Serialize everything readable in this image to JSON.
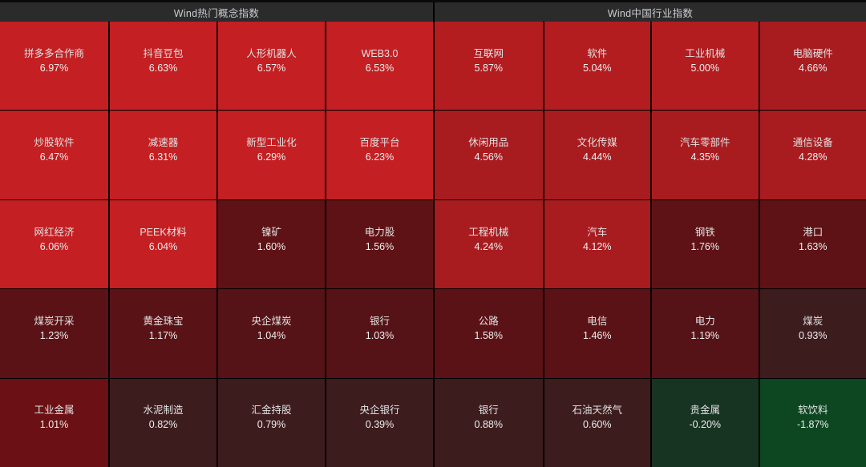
{
  "panels": [
    {
      "title": "Wind热门概念指数",
      "rows": [
        [
          {
            "name": "拼多多合作商",
            "value": "6.97%",
            "color": "#c41f22"
          },
          {
            "name": "抖音豆包",
            "value": "6.63%",
            "color": "#c41f22"
          },
          {
            "name": "人形机器人",
            "value": "6.57%",
            "color": "#c41f22"
          },
          {
            "name": "WEB3.0",
            "value": "6.53%",
            "color": "#c41f22"
          }
        ],
        [
          {
            "name": "炒股软件",
            "value": "6.47%",
            "color": "#c41f22"
          },
          {
            "name": "减速器",
            "value": "6.31%",
            "color": "#c41f22"
          },
          {
            "name": "新型工业化",
            "value": "6.29%",
            "color": "#c41f22"
          },
          {
            "name": "百度平台",
            "value": "6.23%",
            "color": "#c41f22"
          }
        ],
        [
          {
            "name": "网红经济",
            "value": "6.06%",
            "color": "#c41f22"
          },
          {
            "name": "PEEK材料",
            "value": "6.04%",
            "color": "#c41f22"
          },
          {
            "name": "镍矿",
            "value": "1.60%",
            "color": "#5e1215"
          },
          {
            "name": "电力股",
            "value": "1.56%",
            "color": "#5e1215"
          }
        ],
        [
          {
            "name": "煤炭开采",
            "value": "1.23%",
            "color": "#5b1216"
          },
          {
            "name": "黄金珠宝",
            "value": "1.17%",
            "color": "#591317"
          },
          {
            "name": "央企煤炭",
            "value": "1.04%",
            "color": "#561317"
          },
          {
            "name": "银行",
            "value": "1.03%",
            "color": "#561317"
          }
        ],
        [
          {
            "name": "工业金属",
            "value": "1.01%",
            "color": "#6b1014"
          },
          {
            "name": "水泥制造",
            "value": "0.82%",
            "color": "#3d1c1e"
          },
          {
            "name": "汇金持股",
            "value": "0.79%",
            "color": "#3d1c1e"
          },
          {
            "name": "央企银行",
            "value": "0.39%",
            "color": "#3d1c1e"
          }
        ]
      ]
    },
    {
      "title": "Wind中国行业指数",
      "rows": [
        [
          {
            "name": "互联网",
            "value": "5.87%",
            "color": "#b31d20"
          },
          {
            "name": "软件",
            "value": "5.04%",
            "color": "#b31d20"
          },
          {
            "name": "工业机械",
            "value": "5.00%",
            "color": "#b31d20"
          },
          {
            "name": "电脑硬件",
            "value": "4.66%",
            "color": "#a81c20"
          }
        ],
        [
          {
            "name": "休闲用品",
            "value": "4.56%",
            "color": "#a81c20"
          },
          {
            "name": "文化传媒",
            "value": "4.44%",
            "color": "#a81c20"
          },
          {
            "name": "汽车零部件",
            "value": "4.35%",
            "color": "#a81c20"
          },
          {
            "name": "通信设备",
            "value": "4.28%",
            "color": "#a81c20"
          }
        ],
        [
          {
            "name": "工程机械",
            "value": "4.24%",
            "color": "#a81c20"
          },
          {
            "name": "汽车",
            "value": "4.12%",
            "color": "#a81c20"
          },
          {
            "name": "钢铁",
            "value": "1.76%",
            "color": "#5e1215"
          },
          {
            "name": "港口",
            "value": "1.63%",
            "color": "#5e1215"
          }
        ],
        [
          {
            "name": "公路",
            "value": "1.58%",
            "color": "#5b1216"
          },
          {
            "name": "电信",
            "value": "1.46%",
            "color": "#5b1216"
          },
          {
            "name": "电力",
            "value": "1.19%",
            "color": "#561317"
          },
          {
            "name": "煤炭",
            "value": "0.93%",
            "color": "#3d1c1e"
          }
        ],
        [
          {
            "name": "银行",
            "value": "0.88%",
            "color": "#3d1c1e"
          },
          {
            "name": "石油天然气",
            "value": "0.60%",
            "color": "#3d1c1e"
          },
          {
            "name": "贵金属",
            "value": "-0.20%",
            "color": "#173322"
          },
          {
            "name": "软饮料",
            "value": "-1.87%",
            "color": "#0d4722"
          }
        ]
      ]
    }
  ],
  "theme": {
    "header_bg": "#2b2b2b",
    "header_text": "#c9ccd1",
    "grid_line": "#000000",
    "cell_text": "#e8e8e8"
  }
}
